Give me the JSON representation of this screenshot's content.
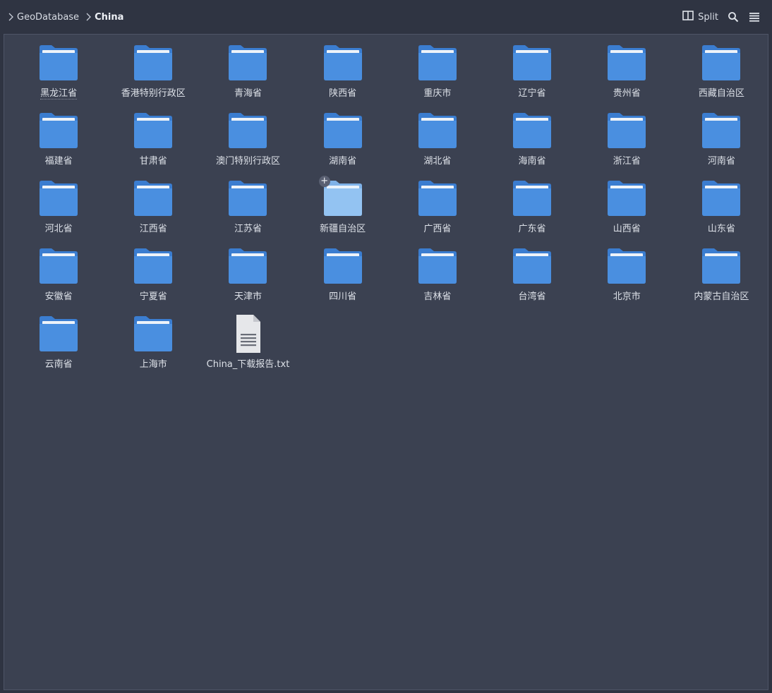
{
  "breadcrumb": [
    {
      "label": "GeoDatabase",
      "current": false
    },
    {
      "label": "China",
      "current": true
    }
  ],
  "toolbar": {
    "split_label": "Split",
    "split_icon": "split-view-icon",
    "search_icon": "search-icon",
    "menu_icon": "hamburger-menu-icon"
  },
  "colors": {
    "folder": "#4a8fe0",
    "folder_light": "#93c3f2",
    "background": "#3b4151",
    "toolbar": "#2f3442"
  },
  "items": [
    {
      "name": "黑龙江省",
      "type": "folder"
    },
    {
      "name": "香港特别行政区",
      "type": "folder"
    },
    {
      "name": "青海省",
      "type": "folder"
    },
    {
      "name": "陕西省",
      "type": "folder"
    },
    {
      "name": "重庆市",
      "type": "folder"
    },
    {
      "name": "辽宁省",
      "type": "folder"
    },
    {
      "name": "贵州省",
      "type": "folder"
    },
    {
      "name": "西藏自治区",
      "type": "folder"
    },
    {
      "name": "福建省",
      "type": "folder"
    },
    {
      "name": "甘肃省",
      "type": "folder"
    },
    {
      "name": "澳门特别行政区",
      "type": "folder"
    },
    {
      "name": "湖南省",
      "type": "folder"
    },
    {
      "name": "湖北省",
      "type": "folder"
    },
    {
      "name": "海南省",
      "type": "folder"
    },
    {
      "name": "浙江省",
      "type": "folder"
    },
    {
      "name": "河南省",
      "type": "folder"
    },
    {
      "name": "河北省",
      "type": "folder"
    },
    {
      "name": "江西省",
      "type": "folder"
    },
    {
      "name": "江苏省",
      "type": "folder"
    },
    {
      "name": "新疆自治区",
      "type": "folder",
      "highlighted": true
    },
    {
      "name": "广西省",
      "type": "folder"
    },
    {
      "name": "广东省",
      "type": "folder"
    },
    {
      "name": "山西省",
      "type": "folder"
    },
    {
      "name": "山东省",
      "type": "folder"
    },
    {
      "name": "安徽省",
      "type": "folder"
    },
    {
      "name": "宁夏省",
      "type": "folder"
    },
    {
      "name": "天津市",
      "type": "folder"
    },
    {
      "name": "四川省",
      "type": "folder"
    },
    {
      "name": "吉林省",
      "type": "folder"
    },
    {
      "name": "台湾省",
      "type": "folder"
    },
    {
      "name": "北京市",
      "type": "folder"
    },
    {
      "name": "内蒙古自治区",
      "type": "folder"
    },
    {
      "name": "云南省",
      "type": "folder"
    },
    {
      "name": "上海市",
      "type": "folder"
    },
    {
      "name": "China_下载报告.txt",
      "type": "text-file"
    }
  ]
}
